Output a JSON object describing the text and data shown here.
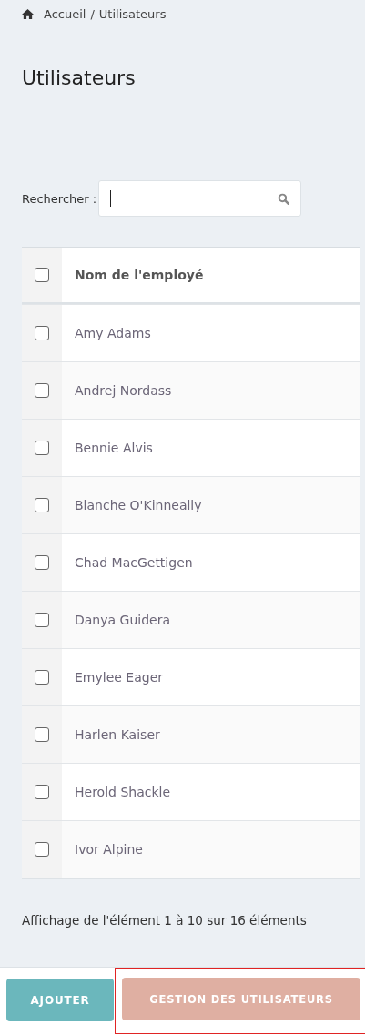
{
  "breadcrumb": {
    "home": "Accueil",
    "separator": "/",
    "current": "Utilisateurs"
  },
  "title": "Utilisateurs",
  "search": {
    "label": "Rechercher :"
  },
  "table": {
    "header": {
      "label": "Nom de l'employé",
      "checked": false
    },
    "rows": [
      {
        "name": "Amy Adams",
        "checked": false
      },
      {
        "name": "Andrej Nordass",
        "checked": false
      },
      {
        "name": "Bennie Alvis",
        "checked": false
      },
      {
        "name": "Blanche O'Kinneally",
        "checked": false
      },
      {
        "name": "Chad MacGettigen",
        "checked": false
      },
      {
        "name": "Danya Guidera",
        "checked": false
      },
      {
        "name": "Emylee Eager",
        "checked": false
      },
      {
        "name": "Harlen Kaiser",
        "checked": false
      },
      {
        "name": "Herold Shackle",
        "checked": false
      },
      {
        "name": "Ivor Alpine",
        "checked": false
      }
    ]
  },
  "info": "Affichage de l'élément 1 à 10 sur 16 éléments",
  "buttons": [
    {
      "label": "AJOUTER",
      "kind": "primary",
      "highlighted": false
    },
    {
      "label": "GESTION DES UTILISATEURS",
      "kind": "secondary",
      "highlighted": true
    }
  ]
}
